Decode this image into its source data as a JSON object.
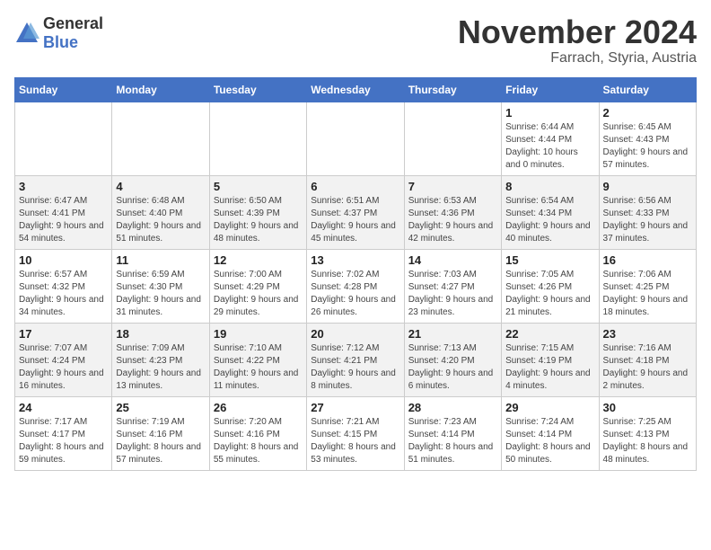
{
  "logo": {
    "general": "General",
    "blue": "Blue"
  },
  "title": {
    "month": "November 2024",
    "location": "Farrach, Styria, Austria"
  },
  "weekdays": [
    "Sunday",
    "Monday",
    "Tuesday",
    "Wednesday",
    "Thursday",
    "Friday",
    "Saturday"
  ],
  "rows": [
    [
      {
        "day": "",
        "info": ""
      },
      {
        "day": "",
        "info": ""
      },
      {
        "day": "",
        "info": ""
      },
      {
        "day": "",
        "info": ""
      },
      {
        "day": "",
        "info": ""
      },
      {
        "day": "1",
        "info": "Sunrise: 6:44 AM\nSunset: 4:44 PM\nDaylight: 10 hours and 0 minutes."
      },
      {
        "day": "2",
        "info": "Sunrise: 6:45 AM\nSunset: 4:43 PM\nDaylight: 9 hours and 57 minutes."
      }
    ],
    [
      {
        "day": "3",
        "info": "Sunrise: 6:47 AM\nSunset: 4:41 PM\nDaylight: 9 hours and 54 minutes."
      },
      {
        "day": "4",
        "info": "Sunrise: 6:48 AM\nSunset: 4:40 PM\nDaylight: 9 hours and 51 minutes."
      },
      {
        "day": "5",
        "info": "Sunrise: 6:50 AM\nSunset: 4:39 PM\nDaylight: 9 hours and 48 minutes."
      },
      {
        "day": "6",
        "info": "Sunrise: 6:51 AM\nSunset: 4:37 PM\nDaylight: 9 hours and 45 minutes."
      },
      {
        "day": "7",
        "info": "Sunrise: 6:53 AM\nSunset: 4:36 PM\nDaylight: 9 hours and 42 minutes."
      },
      {
        "day": "8",
        "info": "Sunrise: 6:54 AM\nSunset: 4:34 PM\nDaylight: 9 hours and 40 minutes."
      },
      {
        "day": "9",
        "info": "Sunrise: 6:56 AM\nSunset: 4:33 PM\nDaylight: 9 hours and 37 minutes."
      }
    ],
    [
      {
        "day": "10",
        "info": "Sunrise: 6:57 AM\nSunset: 4:32 PM\nDaylight: 9 hours and 34 minutes."
      },
      {
        "day": "11",
        "info": "Sunrise: 6:59 AM\nSunset: 4:30 PM\nDaylight: 9 hours and 31 minutes."
      },
      {
        "day": "12",
        "info": "Sunrise: 7:00 AM\nSunset: 4:29 PM\nDaylight: 9 hours and 29 minutes."
      },
      {
        "day": "13",
        "info": "Sunrise: 7:02 AM\nSunset: 4:28 PM\nDaylight: 9 hours and 26 minutes."
      },
      {
        "day": "14",
        "info": "Sunrise: 7:03 AM\nSunset: 4:27 PM\nDaylight: 9 hours and 23 minutes."
      },
      {
        "day": "15",
        "info": "Sunrise: 7:05 AM\nSunset: 4:26 PM\nDaylight: 9 hours and 21 minutes."
      },
      {
        "day": "16",
        "info": "Sunrise: 7:06 AM\nSunset: 4:25 PM\nDaylight: 9 hours and 18 minutes."
      }
    ],
    [
      {
        "day": "17",
        "info": "Sunrise: 7:07 AM\nSunset: 4:24 PM\nDaylight: 9 hours and 16 minutes."
      },
      {
        "day": "18",
        "info": "Sunrise: 7:09 AM\nSunset: 4:23 PM\nDaylight: 9 hours and 13 minutes."
      },
      {
        "day": "19",
        "info": "Sunrise: 7:10 AM\nSunset: 4:22 PM\nDaylight: 9 hours and 11 minutes."
      },
      {
        "day": "20",
        "info": "Sunrise: 7:12 AM\nSunset: 4:21 PM\nDaylight: 9 hours and 8 minutes."
      },
      {
        "day": "21",
        "info": "Sunrise: 7:13 AM\nSunset: 4:20 PM\nDaylight: 9 hours and 6 minutes."
      },
      {
        "day": "22",
        "info": "Sunrise: 7:15 AM\nSunset: 4:19 PM\nDaylight: 9 hours and 4 minutes."
      },
      {
        "day": "23",
        "info": "Sunrise: 7:16 AM\nSunset: 4:18 PM\nDaylight: 9 hours and 2 minutes."
      }
    ],
    [
      {
        "day": "24",
        "info": "Sunrise: 7:17 AM\nSunset: 4:17 PM\nDaylight: 8 hours and 59 minutes."
      },
      {
        "day": "25",
        "info": "Sunrise: 7:19 AM\nSunset: 4:16 PM\nDaylight: 8 hours and 57 minutes."
      },
      {
        "day": "26",
        "info": "Sunrise: 7:20 AM\nSunset: 4:16 PM\nDaylight: 8 hours and 55 minutes."
      },
      {
        "day": "27",
        "info": "Sunrise: 7:21 AM\nSunset: 4:15 PM\nDaylight: 8 hours and 53 minutes."
      },
      {
        "day": "28",
        "info": "Sunrise: 7:23 AM\nSunset: 4:14 PM\nDaylight: 8 hours and 51 minutes."
      },
      {
        "day": "29",
        "info": "Sunrise: 7:24 AM\nSunset: 4:14 PM\nDaylight: 8 hours and 50 minutes."
      },
      {
        "day": "30",
        "info": "Sunrise: 7:25 AM\nSunset: 4:13 PM\nDaylight: 8 hours and 48 minutes."
      }
    ]
  ]
}
